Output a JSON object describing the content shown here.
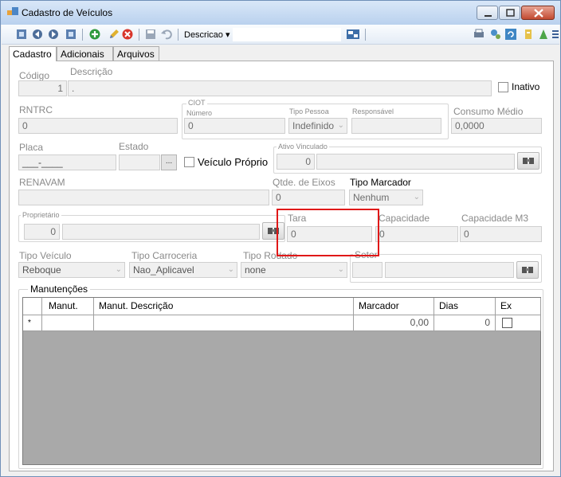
{
  "window": {
    "title": "Cadastro de Veículos"
  },
  "toolbar": {
    "field_dropdown": "Descricao"
  },
  "tabs": [
    "Cadastro",
    "Adicionais",
    "Arquivos"
  ],
  "form": {
    "codigo": {
      "label": "Código",
      "value": "1"
    },
    "descricao": {
      "label": "Descrição",
      "value": "."
    },
    "inativo": {
      "label": "Inativo"
    },
    "rntrc": {
      "label": "RNTRC",
      "value": "0"
    },
    "ciot": {
      "group_label": "CIOT",
      "numero_label": "Número",
      "numero_value": "0",
      "tipo_pessoa_label": "Tipo Pessoa",
      "tipo_pessoa_value": "Indefinido",
      "responsavel_label": "Responsável",
      "responsavel_value": ""
    },
    "consumo_medio": {
      "label": "Consumo Médio",
      "value": "0,0000"
    },
    "placa": {
      "label": "Placa",
      "value": "___-____"
    },
    "estado": {
      "label": "Estado",
      "value": "",
      "button": "..."
    },
    "veiculo_proprio": {
      "label": "Veículo Próprio"
    },
    "ativo_vinculado": {
      "label": "Ativo Vinculado",
      "value": "0"
    },
    "renavam": {
      "label": "RENAVAM",
      "value": ""
    },
    "qtde_eixos": {
      "label": "Qtde. de Eixos",
      "value": "0"
    },
    "tipo_marcador": {
      "label": "Tipo Marcador",
      "value": "Nenhum"
    },
    "proprietario": {
      "label": "Proprietário",
      "value": "0"
    },
    "tara": {
      "label": "Tara",
      "value": "0"
    },
    "capacidade": {
      "label": "Capacidade",
      "value": "0"
    },
    "capacidade_m3": {
      "label": "Capacidade M3",
      "value": "0"
    },
    "tipo_veiculo": {
      "label": "Tipo Veículo",
      "value": "Reboque"
    },
    "tipo_carroceria": {
      "label": "Tipo Carroceria",
      "value": "Nao_Aplicavel"
    },
    "tipo_rodado": {
      "label": "Tipo Rodado",
      "value": "none"
    },
    "setor": {
      "label": "Setor",
      "value": ""
    }
  },
  "manutencoes": {
    "title": "Manutenções",
    "columns": [
      "Manut.",
      "Manut. Descrição",
      "Marcador",
      "Dias",
      "Ex"
    ],
    "new_row": {
      "indicator": "*",
      "manut": "",
      "descricao": "",
      "marcador": "0,00",
      "dias": "0"
    }
  },
  "colors": {
    "highlight": "#e01818",
    "title_bar": "#c9dcf3",
    "grid_bg": "#a9a9a9"
  }
}
